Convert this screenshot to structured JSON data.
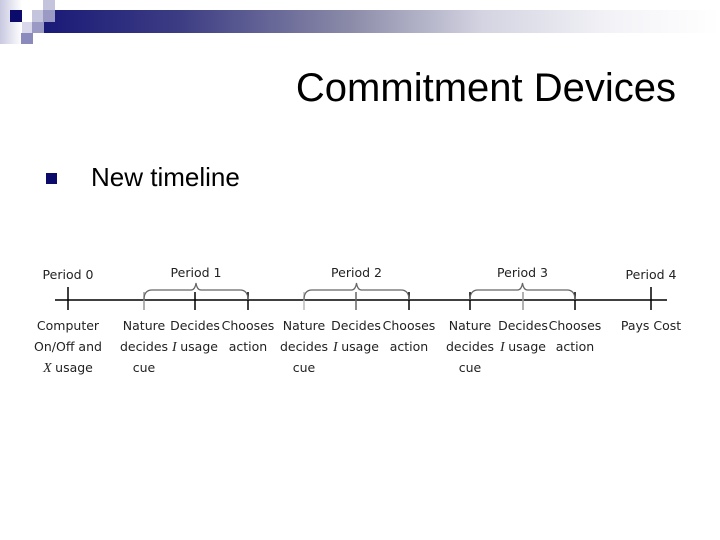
{
  "slide": {
    "title": "Commitment Devices",
    "bullets": [
      {
        "icon": "square-bullet-icon",
        "text": "New timeline"
      }
    ]
  },
  "theme": {
    "accent_dark": "#1a1a78",
    "bullet_color": "#0b0b6b"
  },
  "timeline": {
    "periods": [
      {
        "label": "Period 0",
        "type": "point"
      },
      {
        "label": "Period 1",
        "type": "brace"
      },
      {
        "label": "Period 2",
        "type": "brace"
      },
      {
        "label": "Period 3",
        "type": "brace"
      },
      {
        "label": "Period 4",
        "type": "point"
      }
    ],
    "events": [
      {
        "lines": [
          "Computer",
          "On/Off and",
          "X usage"
        ],
        "italic_var": "X"
      },
      {
        "lines": [
          "Nature",
          "decides",
          "cue"
        ]
      },
      {
        "lines": [
          "Decides",
          "I usage"
        ],
        "italic_var": "I"
      },
      {
        "lines": [
          "Chooses",
          "action"
        ]
      },
      {
        "lines": [
          "Nature",
          "decides",
          "cue"
        ]
      },
      {
        "lines": [
          "Decides",
          "I usage"
        ],
        "italic_var": "I"
      },
      {
        "lines": [
          "Chooses",
          "action"
        ]
      },
      {
        "lines": [
          "Nature",
          "decides",
          "cue"
        ]
      },
      {
        "lines": [
          "Decides",
          "I usage"
        ],
        "italic_var": "I"
      },
      {
        "lines": [
          "Chooses",
          "action"
        ]
      },
      {
        "lines": [
          "Pays Cost"
        ]
      }
    ]
  }
}
